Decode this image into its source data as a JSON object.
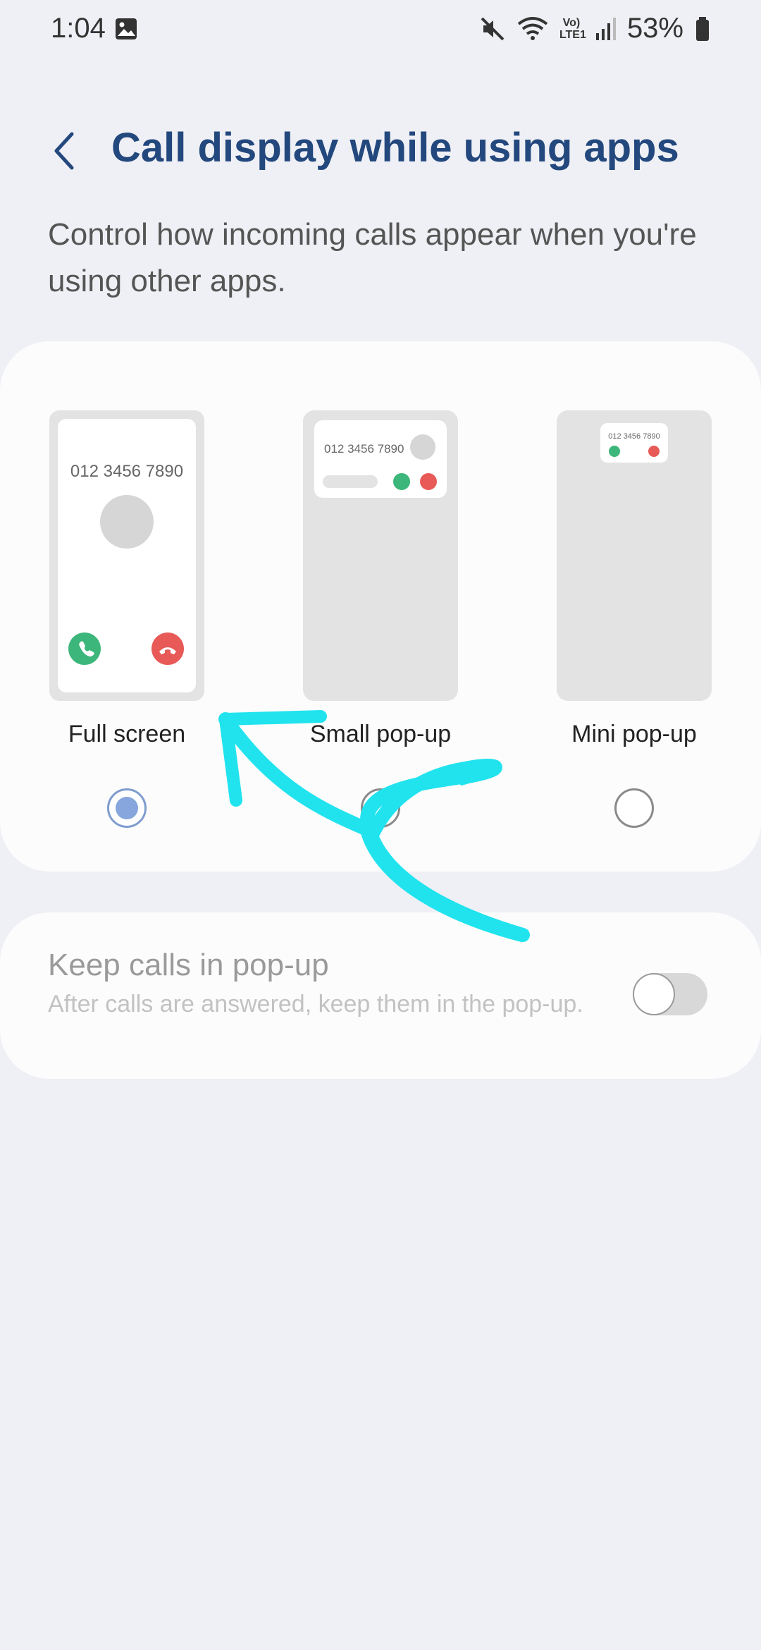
{
  "status_bar": {
    "time": "1:04",
    "battery": "53%",
    "network": "Vo) LTE1",
    "icons": [
      "gallery-icon",
      "mute-icon",
      "wifi-icon",
      "signal-icon",
      "battery-icon"
    ]
  },
  "header": {
    "title": "Call display while using apps",
    "description": "Control how incoming calls appear when you're using other apps."
  },
  "options": [
    {
      "label": "Full screen",
      "selected": true,
      "phone_number": "012 3456 7890"
    },
    {
      "label": "Small pop-up",
      "selected": false,
      "phone_number": "012 3456 7890"
    },
    {
      "label": "Mini pop-up",
      "selected": false,
      "phone_number": "012 3456 7890"
    }
  ],
  "keep_calls": {
    "title": "Keep calls in pop-up",
    "subtitle": "After calls are answered, keep them in the pop-up.",
    "enabled": false
  },
  "colors": {
    "title": "#23487d",
    "answer": "#3cb67a",
    "decline": "#e85a57",
    "annotation": "#20e3ee"
  }
}
